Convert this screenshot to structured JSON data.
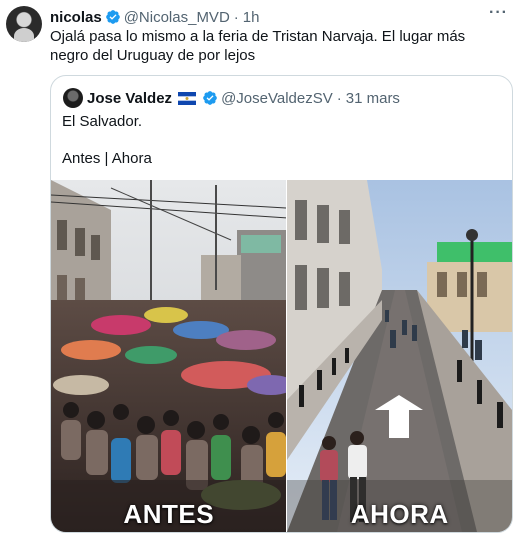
{
  "tweet": {
    "author_name": "nicolas",
    "author_handle": "@Nicolas_MVD",
    "separator": "·",
    "time": "1h",
    "more_label": "···",
    "text": "Ojalá pasa lo mismo a la feria de Tristan Narvaja. El lugar más negro del Uruguay de por lejos"
  },
  "quote": {
    "author_name": "Jose Valdez",
    "author_handle": "@JoseValdezSV",
    "separator": "·",
    "date": "31 mars",
    "text_line1": "El Salvador.",
    "text_line2": "Antes | Ahora",
    "media": {
      "left_caption": "ANTES",
      "right_caption": "AHORA"
    }
  },
  "colors": {
    "verified_blue": "#1d9bf0",
    "text_secondary": "#536471",
    "border": "#cfd9de"
  },
  "icons": [
    "verified-badge-icon",
    "el-salvador-flag-icon",
    "more-icon"
  ]
}
